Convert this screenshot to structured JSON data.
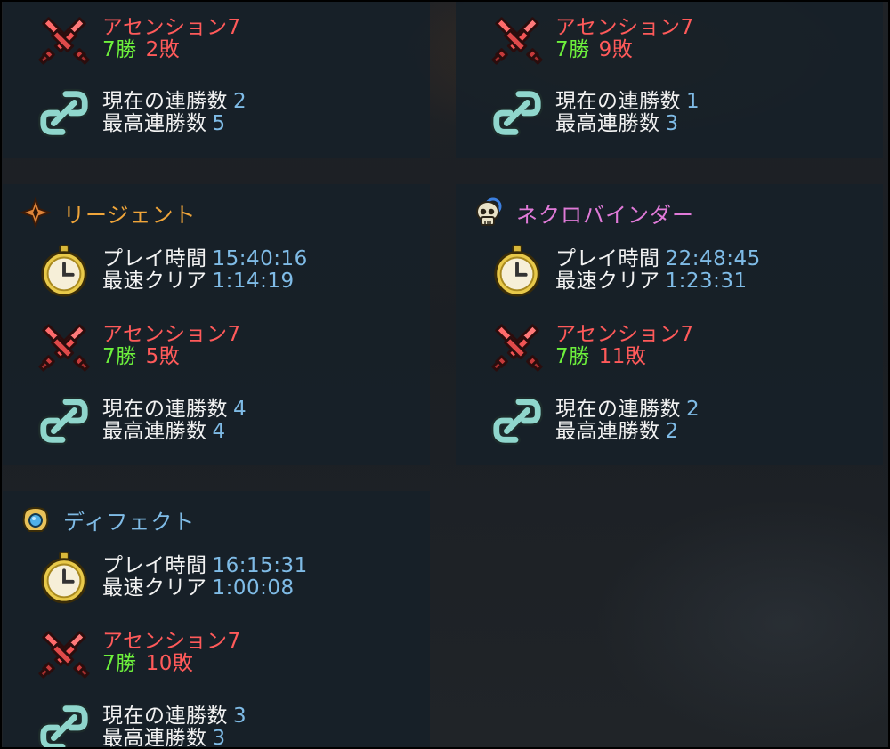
{
  "labels": {
    "playtime": "プレイ時間",
    "fastest": "最速クリア",
    "ascension": "アセンション",
    "wins_suffix": "勝",
    "losses_suffix": "敗",
    "current_streak": "現在の連勝数",
    "best_streak": "最高連勝数"
  },
  "colors": {
    "regent": "#f0a53a",
    "necrobinder": "#e07ad8",
    "defect": "#7fbbe6",
    "value": "#7fbbe6",
    "wins": "#6df03c",
    "ascension": "#ff5a5a"
  },
  "panels": {
    "top_left": {
      "ascension": "7",
      "wins": "7",
      "losses": "2",
      "current_streak": "2",
      "best_streak": "5"
    },
    "top_right": {
      "ascension": "7",
      "wins": "7",
      "losses": "9",
      "current_streak": "1",
      "best_streak": "3"
    },
    "regent": {
      "name": "リージェント",
      "icon": "regent-crown-icon",
      "playtime": "15:40:16",
      "fastest": "1:14:19",
      "ascension": "7",
      "wins": "7",
      "losses": "5",
      "current_streak": "4",
      "best_streak": "4"
    },
    "necrobinder": {
      "name": "ネクロバインダー",
      "icon": "skull-icon",
      "playtime": "22:48:45",
      "fastest": "1:23:31",
      "ascension": "7",
      "wins": "7",
      "losses": "11",
      "current_streak": "2",
      "best_streak": "2"
    },
    "defect": {
      "name": "ディフェクト",
      "icon": "orb-icon",
      "playtime": "16:15:31",
      "fastest": "1:00:08",
      "ascension": "7",
      "wins": "7",
      "losses": "10",
      "current_streak": "3",
      "best_streak": "3"
    }
  }
}
